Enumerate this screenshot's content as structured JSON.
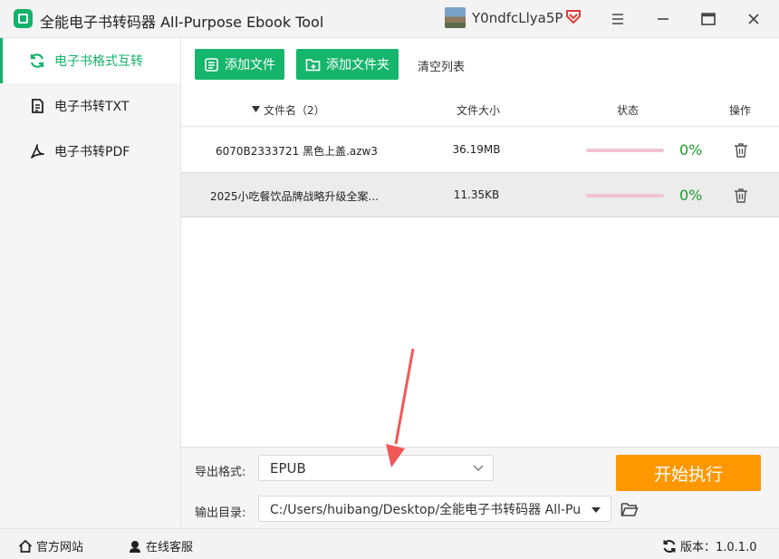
{
  "app": {
    "title": "全能电子书转码器 All-Purpose Ebook Tool",
    "username": "Y0ndfcLlya5P",
    "colors": {
      "accent": "#12b26a",
      "start": "#ff9800",
      "percent": "#1f9a2a",
      "progress_track": "#f2c3d3"
    }
  },
  "sidebar": {
    "items": [
      {
        "label": "电子书格式互转",
        "icon": "refresh-icon",
        "active": true
      },
      {
        "label": "电子书转TXT",
        "icon": "document-icon",
        "active": false
      },
      {
        "label": "电子书转PDF",
        "icon": "pdf-icon",
        "active": false
      }
    ]
  },
  "toolbar": {
    "add_file": "添加文件",
    "add_folder": "添加文件夹",
    "clear_list": "清空列表"
  },
  "table": {
    "headers": {
      "name": "文件名（2）",
      "size": "文件大小",
      "status": "状态",
      "action": "操作"
    },
    "rows": [
      {
        "name": "6070B2333721 黑色上盖.azw3",
        "size": "36.19MB",
        "progress": 0,
        "percent": "0%"
      },
      {
        "name": "2025小吃餐饮品牌战略升级全案...",
        "size": "11.35KB",
        "progress": 0,
        "percent": "0%"
      }
    ]
  },
  "settings": {
    "format_label": "导出格式:",
    "format_value": "EPUB",
    "dir_label": "输出目录:",
    "dir_value": "C:/Users/huibang/Desktop/全能电子书转码器 All-Pu",
    "start": "开始执行"
  },
  "statusbar": {
    "website": "官方网站",
    "support": "在线客服",
    "version": "版本：1.0.1.0"
  }
}
